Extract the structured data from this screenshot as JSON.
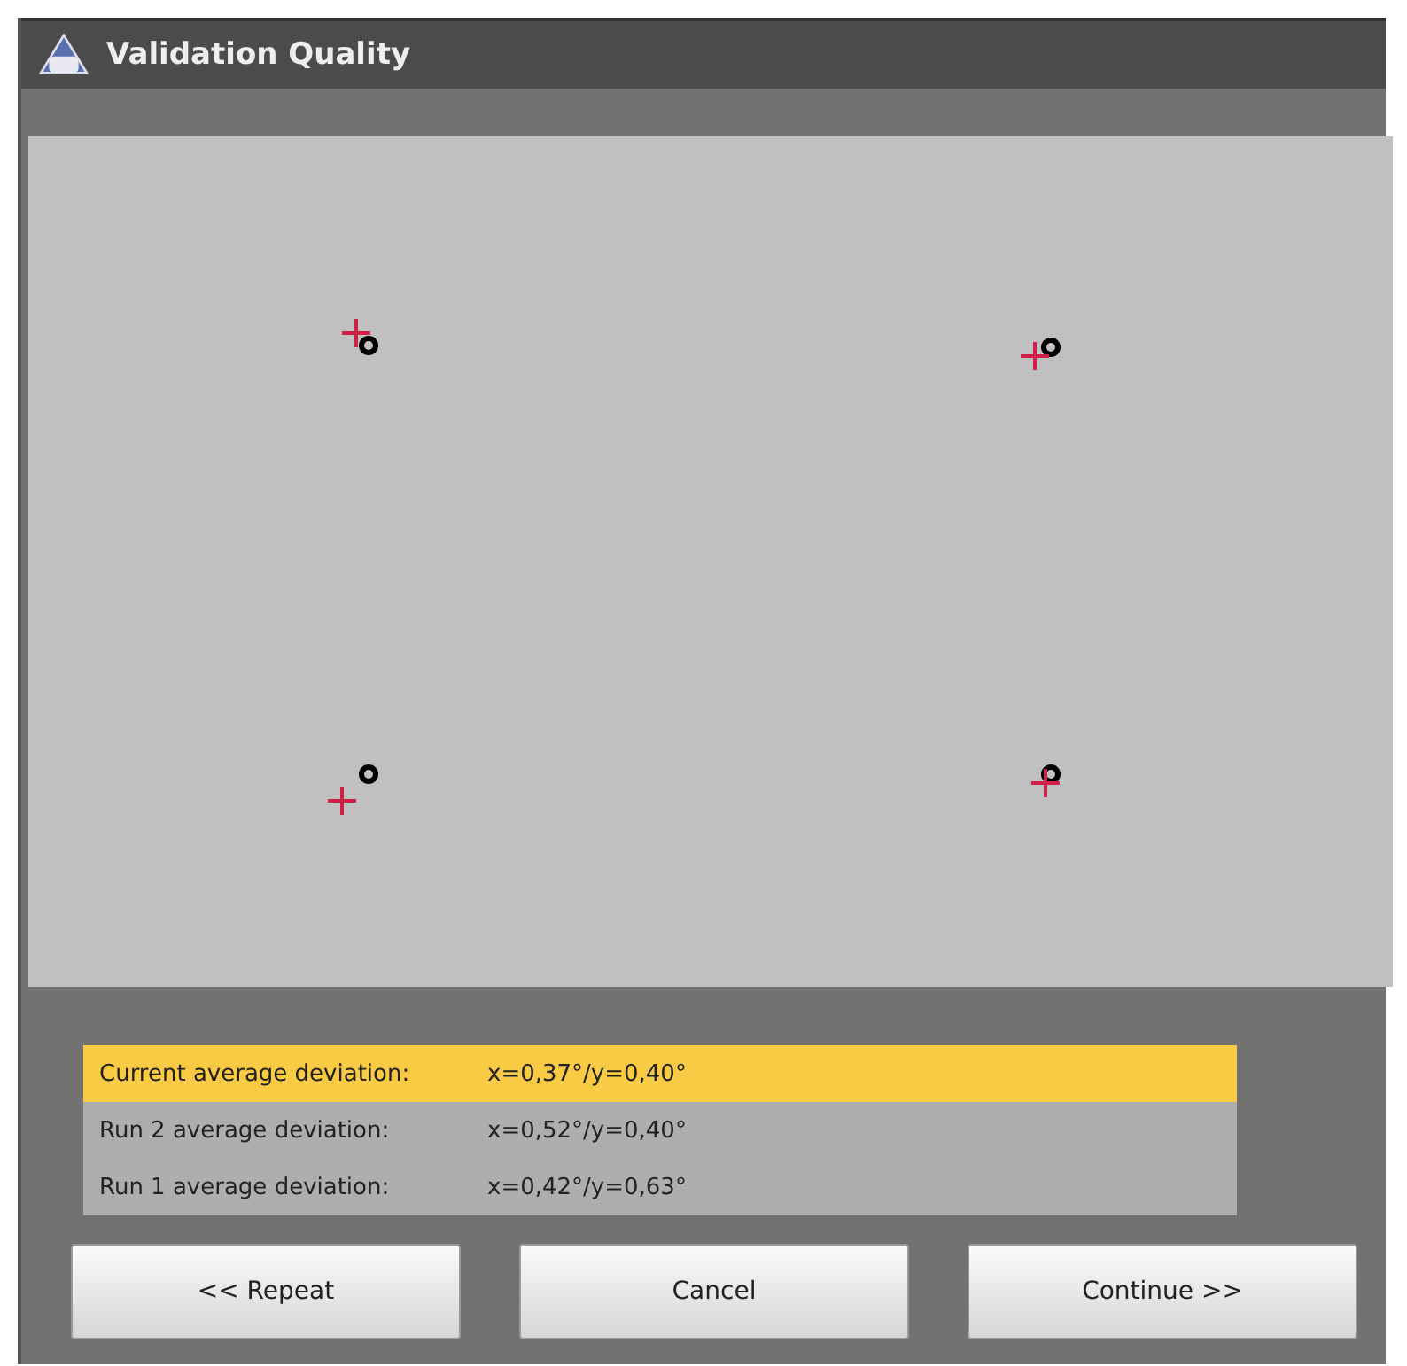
{
  "window": {
    "title": "Validation Quality"
  },
  "results": [
    {
      "label": "Current average deviation:",
      "value": "x=0,37°/y=0,40°",
      "selected": true
    },
    {
      "label": "Run 2 average deviation:",
      "value": "x=0,52°/y=0,40°",
      "selected": false
    },
    {
      "label": "Run 1 average deviation:",
      "value": "x=0,42°/y=0,63°",
      "selected": false
    }
  ],
  "buttons": [
    "<< Repeat",
    "Cancel",
    "Continue >>"
  ]
}
